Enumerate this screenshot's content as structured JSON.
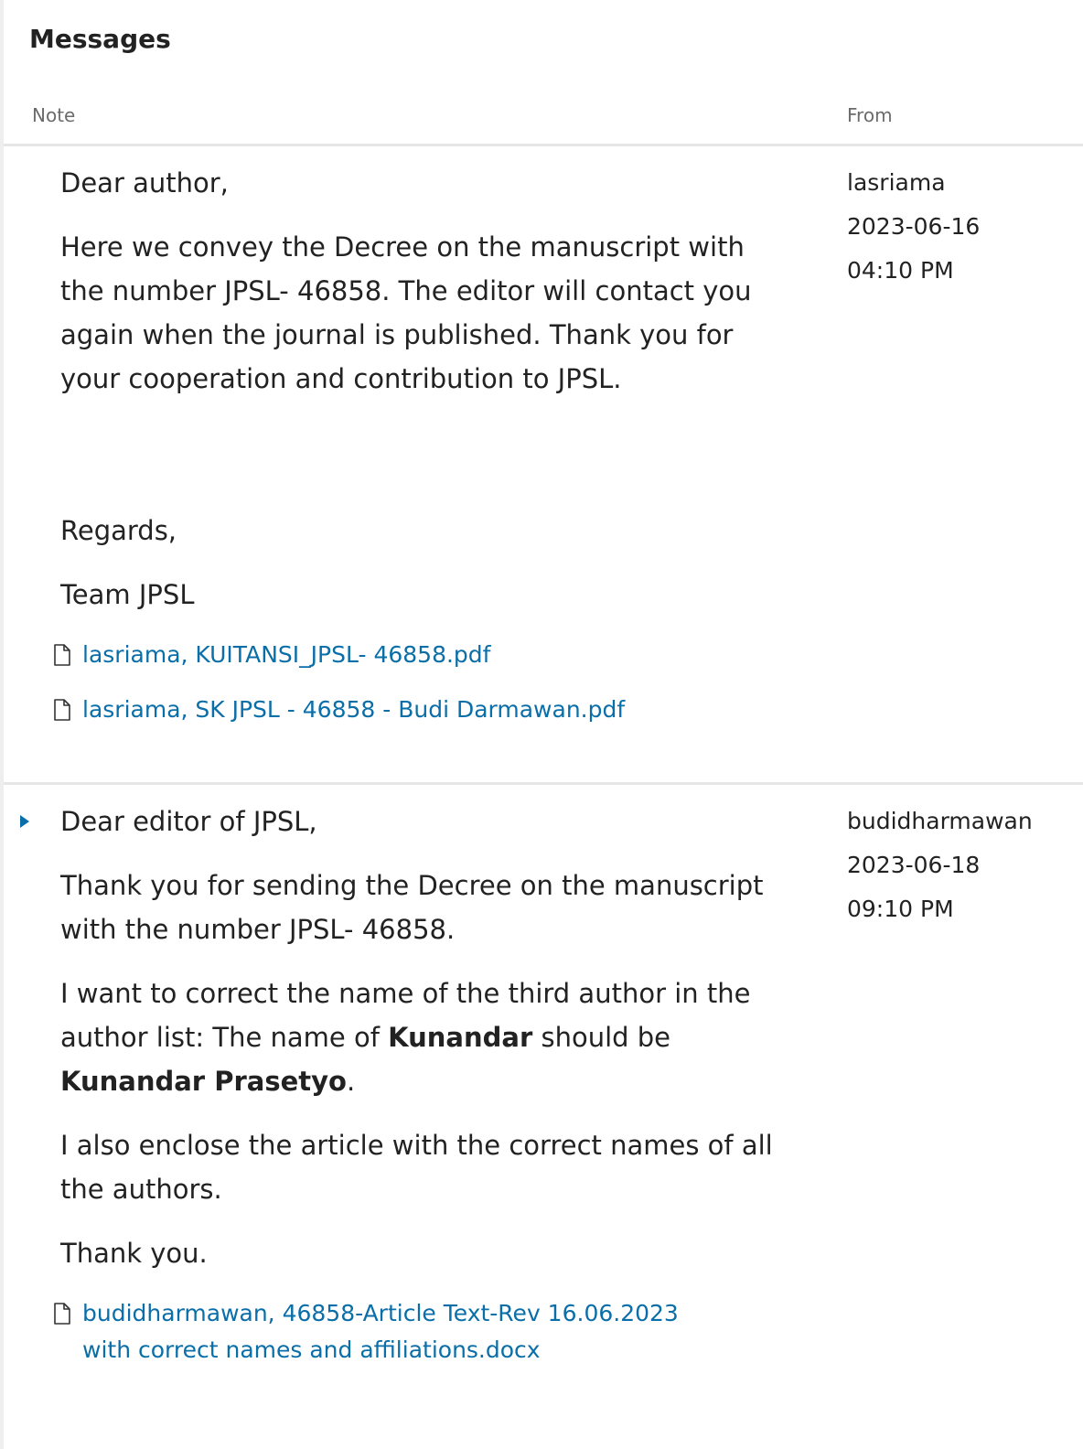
{
  "panel": {
    "title": "Messages",
    "col_note": "Note",
    "col_from": "From"
  },
  "messages": [
    {
      "from": "lasriama",
      "date": "2023-06-16",
      "time": "04:10 PM",
      "greeting": "Dear author,",
      "p1": "Here we convey the Decree on the manuscript with the number JPSL- 46858. The editor will contact you again when the journal is published. Thank you for your cooperation and contribution to JPSL.",
      "p2": "Regards,",
      "p3": "Team JPSL",
      "files": [
        "lasriama, KUITANSI_JPSL- 46858.pdf",
        "lasriama, SK JPSL - 46858 - Budi Darmawan.pdf"
      ]
    },
    {
      "from": "budidharmawan",
      "date": "2023-06-18",
      "time": "09:10 PM",
      "greeting": "Dear editor of JPSL,",
      "p1": "Thank you for sending the Decree on the manuscript with the number JPSL- 46858.",
      "p2_pre": "I want to correct the name of the third author in the author list: The name of ",
      "p2_bold1": "Kunandar",
      "p2_mid": " should be ",
      "p2_bold2": "Kunandar Prasetyo",
      "p2_post": ".",
      "p3": "I also enclose the article with the correct names of all the authors.",
      "p4": "Thank you.",
      "files": [
        "budidharmawan, 46858-Article Text-Rev 16.06.2023 with correct names and affiliations.docx"
      ]
    }
  ],
  "colors": {
    "link": "#0a6ea8",
    "muted": "#6b6b6b",
    "rule": "#e6e6e6"
  },
  "icons": {
    "file": "file-icon",
    "expand": "expand-triangle-icon"
  }
}
